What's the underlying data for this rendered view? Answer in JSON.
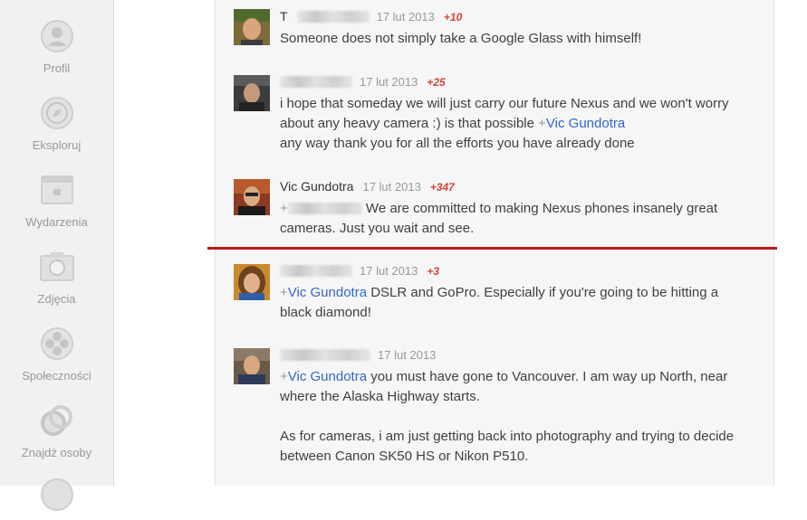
{
  "sidebar": {
    "items": [
      {
        "label": "Profil",
        "icon": "profile-icon"
      },
      {
        "label": "Eksploruj",
        "icon": "compass-icon"
      },
      {
        "label": "Wydarzenia",
        "icon": "calendar-icon"
      },
      {
        "label": "Zdjęcia",
        "icon": "camera-icon"
      },
      {
        "label": "Społeczności",
        "icon": "communities-icon"
      },
      {
        "label": "Znajdź osoby",
        "icon": "circles-icon"
      }
    ]
  },
  "comments": [
    {
      "author": "T",
      "date": "17 lut 2013",
      "plus": "+10",
      "lines": [
        "Someone does not simply take a Google Glass with himself!"
      ]
    },
    {
      "author": "",
      "date": "17 lut 2013",
      "plus": "+25",
      "line1": "i hope that someday we will just carry our future Nexus and we won't worry",
      "line2_pre": "about any heavy camera :) is that possible ",
      "mention_sign": "+",
      "mention": "Vic Gundotra",
      "line3": "any way thank you for all the efforts you have already done"
    },
    {
      "author": "Vic Gundotra",
      "date": "17 lut 2013",
      "plus": "+347",
      "mention_sign": "+",
      "text_after": " We are committed to making Nexus phones insanely great cameras. Just you wait and see."
    },
    {
      "author": "",
      "date": "17 lut 2013",
      "plus": "+3",
      "mention_sign": "+",
      "mention": "Vic Gundotra",
      "text_after": " DSLR and GoPro.  Especially if you're going to be hitting a black diamond!"
    },
    {
      "author": "",
      "date": "17 lut 2013",
      "mention_sign": "+",
      "mention": "Vic Gundotra",
      "text_after": " you must have gone to Vancouver.  I am way up North, near where the Alaska Highway starts.",
      "para2": "As for cameras, i am just getting back into photography and trying to decide between Canon SK50 HS or Nikon P510."
    }
  ],
  "colors": {
    "accent_red": "#c0171a",
    "plus_one": "#d64337",
    "mention_blue": "#3366cc"
  }
}
